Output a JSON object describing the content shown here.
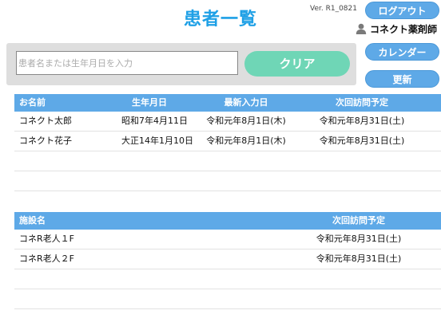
{
  "header": {
    "title": "患者一覧",
    "version": "Ver. R1_0821",
    "logout_label": "ログアウト",
    "user_name": "コネクト薬剤師",
    "calendar_label": "カレンダー",
    "refresh_label": "更新"
  },
  "search": {
    "placeholder": "患者名または生年月日を入力",
    "value": "",
    "clear_label": "クリア"
  },
  "patients": {
    "columns": [
      "お名前",
      "生年月日",
      "最新入力日",
      "次回訪問予定"
    ],
    "rows": [
      [
        "コネクト太郎",
        "昭和7年4月11日",
        "令和元年8月1日(木)",
        "令和元年8月31日(土)"
      ],
      [
        "コネクト花子",
        "大正14年1月10日",
        "令和元年8月1日(木)",
        "令和元年8月31日(土)"
      ]
    ]
  },
  "facilities": {
    "columns": [
      "施設名",
      "次回訪問予定"
    ],
    "rows": [
      [
        "コネR老人１F",
        "令和元年8月31日(土)"
      ],
      [
        "コネR老人２F",
        "令和元年8月31日(土)"
      ]
    ]
  },
  "colors": {
    "accent": "#1ea0e6",
    "header_bg": "#5ea9e7",
    "clear_button": "#6fd6b6"
  },
  "icons": {
    "user": "person-icon"
  }
}
